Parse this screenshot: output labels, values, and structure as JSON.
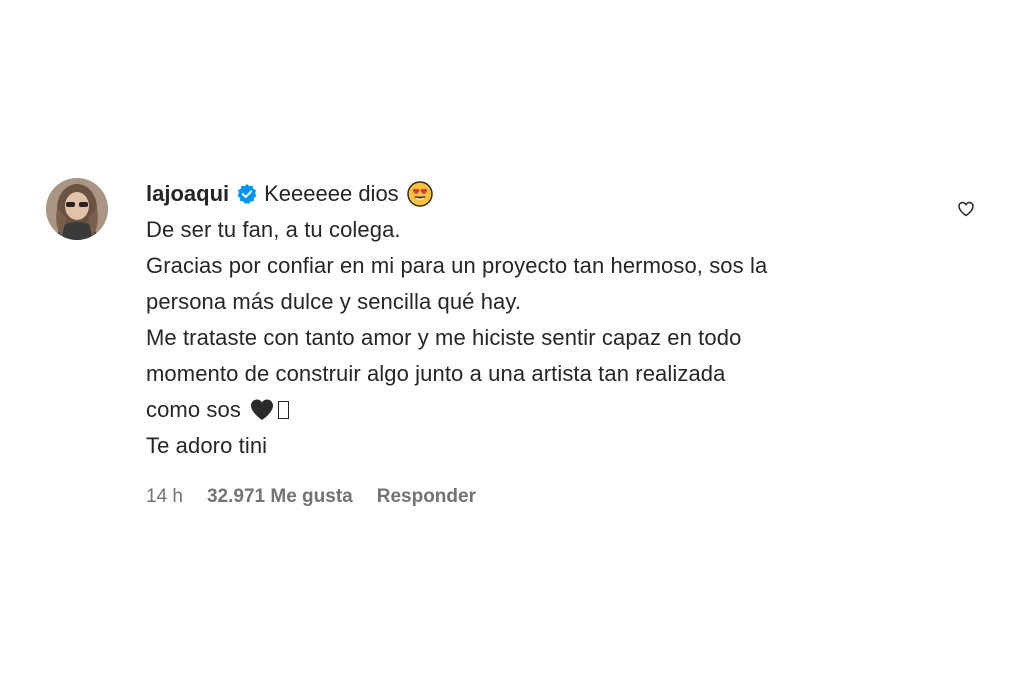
{
  "comment": {
    "username": "lajoaqui",
    "first_text": "Keeeeee dios",
    "lines": [
      "De ser tu fan, a tu colega.",
      "Gracias por confiar en mi para un proyecto tan hermoso, sos la",
      "persona más dulce y sencilla qué hay.",
      "Me trataste con tanto amor y me hiciste sentir capaz en todo",
      "momento de construir algo junto a una artista tan realizada"
    ],
    "emoji_line_text": "como sos",
    "last_line": "Te adoro tini",
    "meta": {
      "time": "14 h",
      "likes": "32.971 Me gusta",
      "reply": "Responder"
    },
    "icons": {
      "verified": "verified-badge-icon",
      "emoji_heart_eyes": "heart-eyes-emoji-icon",
      "black_heart": "black-heart-emoji-icon",
      "like": "heart-outline-icon"
    },
    "colors": {
      "verified": "#0095f6",
      "meta_text": "#737373",
      "text": "#262626"
    }
  }
}
